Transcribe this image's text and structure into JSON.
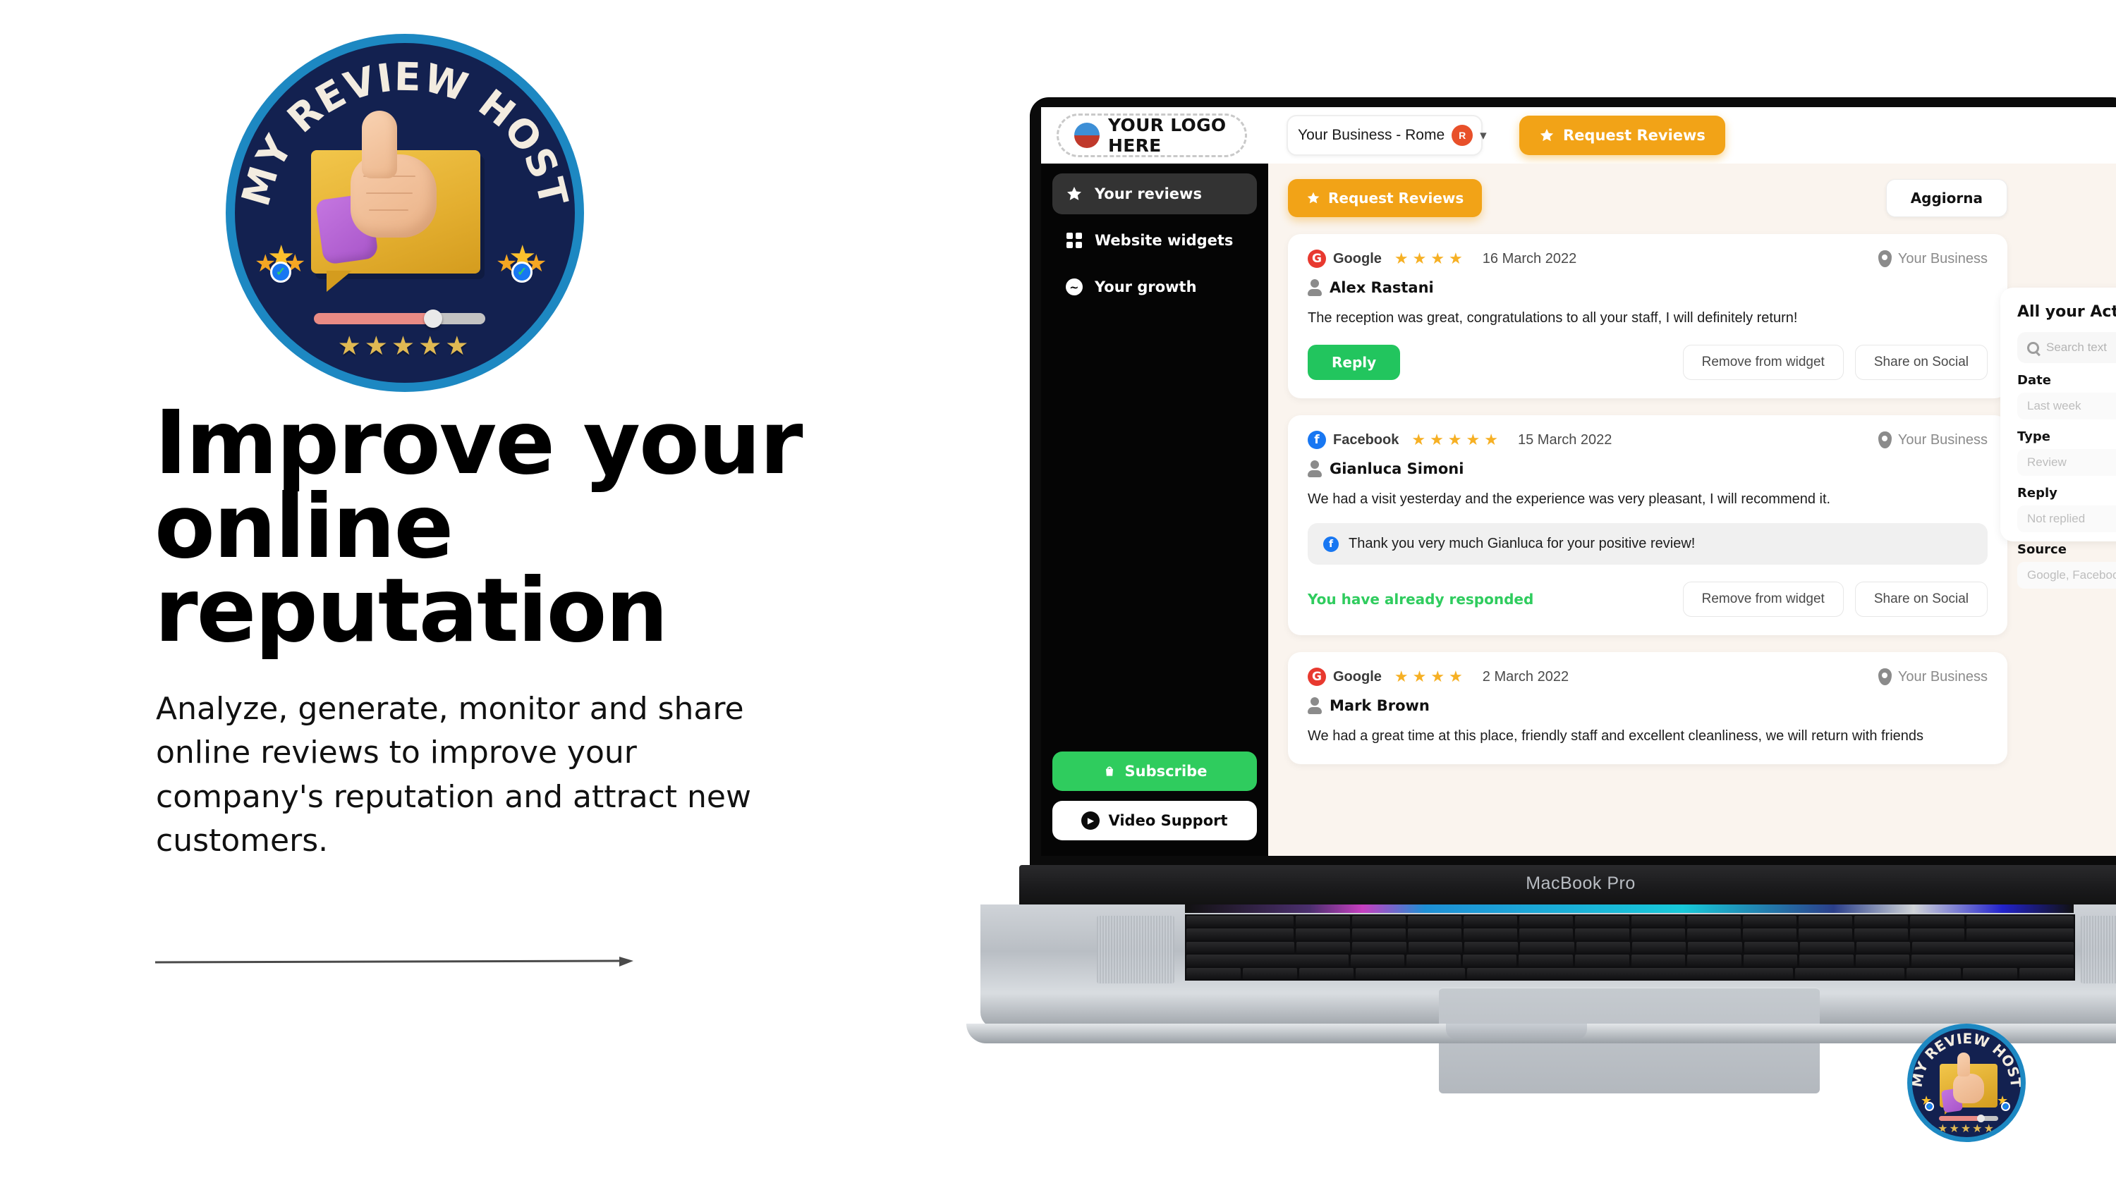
{
  "hero": {
    "logo_text": "MY REVIEW HOST",
    "headline_line1": "Improve your",
    "headline_line2": "online reputation",
    "subcopy": "Analyze, generate, monitor and share online reviews to improve your company's reputation and attract new customers."
  },
  "laptop": {
    "model_label": "MacBook Pro"
  },
  "app": {
    "header": {
      "logo_placeholder": "YOUR LOGO HERE",
      "business_selector": "Your Business - Rome",
      "business_avatar_initial": "R",
      "chevron": "⌄",
      "request_reviews_label": "Request Reviews"
    },
    "sidebar": {
      "items": [
        {
          "label": "Your reviews",
          "icon": "star-icon",
          "active": true
        },
        {
          "label": "Website widgets",
          "icon": "grid-icon",
          "active": false
        },
        {
          "label": "Your growth",
          "icon": "chart-circle-icon",
          "active": false
        }
      ],
      "subscribe_label": "Subscribe",
      "video_support_label": "Video Support"
    },
    "toolbar": {
      "request_reviews_label": "Request Reviews",
      "refresh_label": "Aggiorna"
    },
    "reviews": [
      {
        "source": "Google",
        "source_key": "google",
        "source_initial": "G",
        "stars": "★★★★",
        "star_count": 4,
        "date": "16 March 2022",
        "location": "Your Business",
        "author": "Alex Rastani",
        "text": "The reception was great, congratulations to all your staff, I will definitely return!",
        "reply_label": "Reply",
        "reply_text": null,
        "responded_note": null,
        "remove_label": "Remove from widget",
        "share_label": "Share on Social"
      },
      {
        "source": "Facebook",
        "source_key": "facebook",
        "source_initial": "f",
        "stars": "★★★★★",
        "star_count": 5,
        "date": "15 March 2022",
        "location": "Your Business",
        "author": "Gianluca Simoni",
        "text": "We had a visit yesterday and the experience was very pleasant, I will recommend it.",
        "reply_label": null,
        "reply_text": "Thank you very much Gianluca for your positive review!",
        "responded_note": "You have already responded",
        "remove_label": "Remove from widget",
        "share_label": "Share on Social"
      },
      {
        "source": "Google",
        "source_key": "google",
        "source_initial": "G",
        "stars": "★★★★",
        "star_count": 4,
        "date": "2 March 2022",
        "location": "Your Business",
        "author": "Mark Brown",
        "text": "We had a great time at this place, friendly staff and excellent cleanliness, we will return with friends",
        "reply_label": null,
        "reply_text": null,
        "responded_note": null,
        "remove_label": null,
        "share_label": null
      }
    ],
    "filter_panel": {
      "title": "All your Activity",
      "search_placeholder": "Search text",
      "fields": [
        {
          "label": "Date",
          "value": "Last week"
        },
        {
          "label": "Type",
          "value": "Review"
        },
        {
          "label": "Reply",
          "value": "Not replied"
        },
        {
          "label": "Source",
          "value": "Google, Facebook"
        }
      ]
    }
  },
  "colors": {
    "brand_navy": "#132150",
    "brand_blue": "#1d88c2",
    "accent_orange": "#f2a317",
    "accent_green": "#22c55e",
    "google_red": "#e8392f",
    "facebook_blue": "#1877f2",
    "star_yellow": "#f6b024",
    "app_bg": "#faf4ee"
  }
}
